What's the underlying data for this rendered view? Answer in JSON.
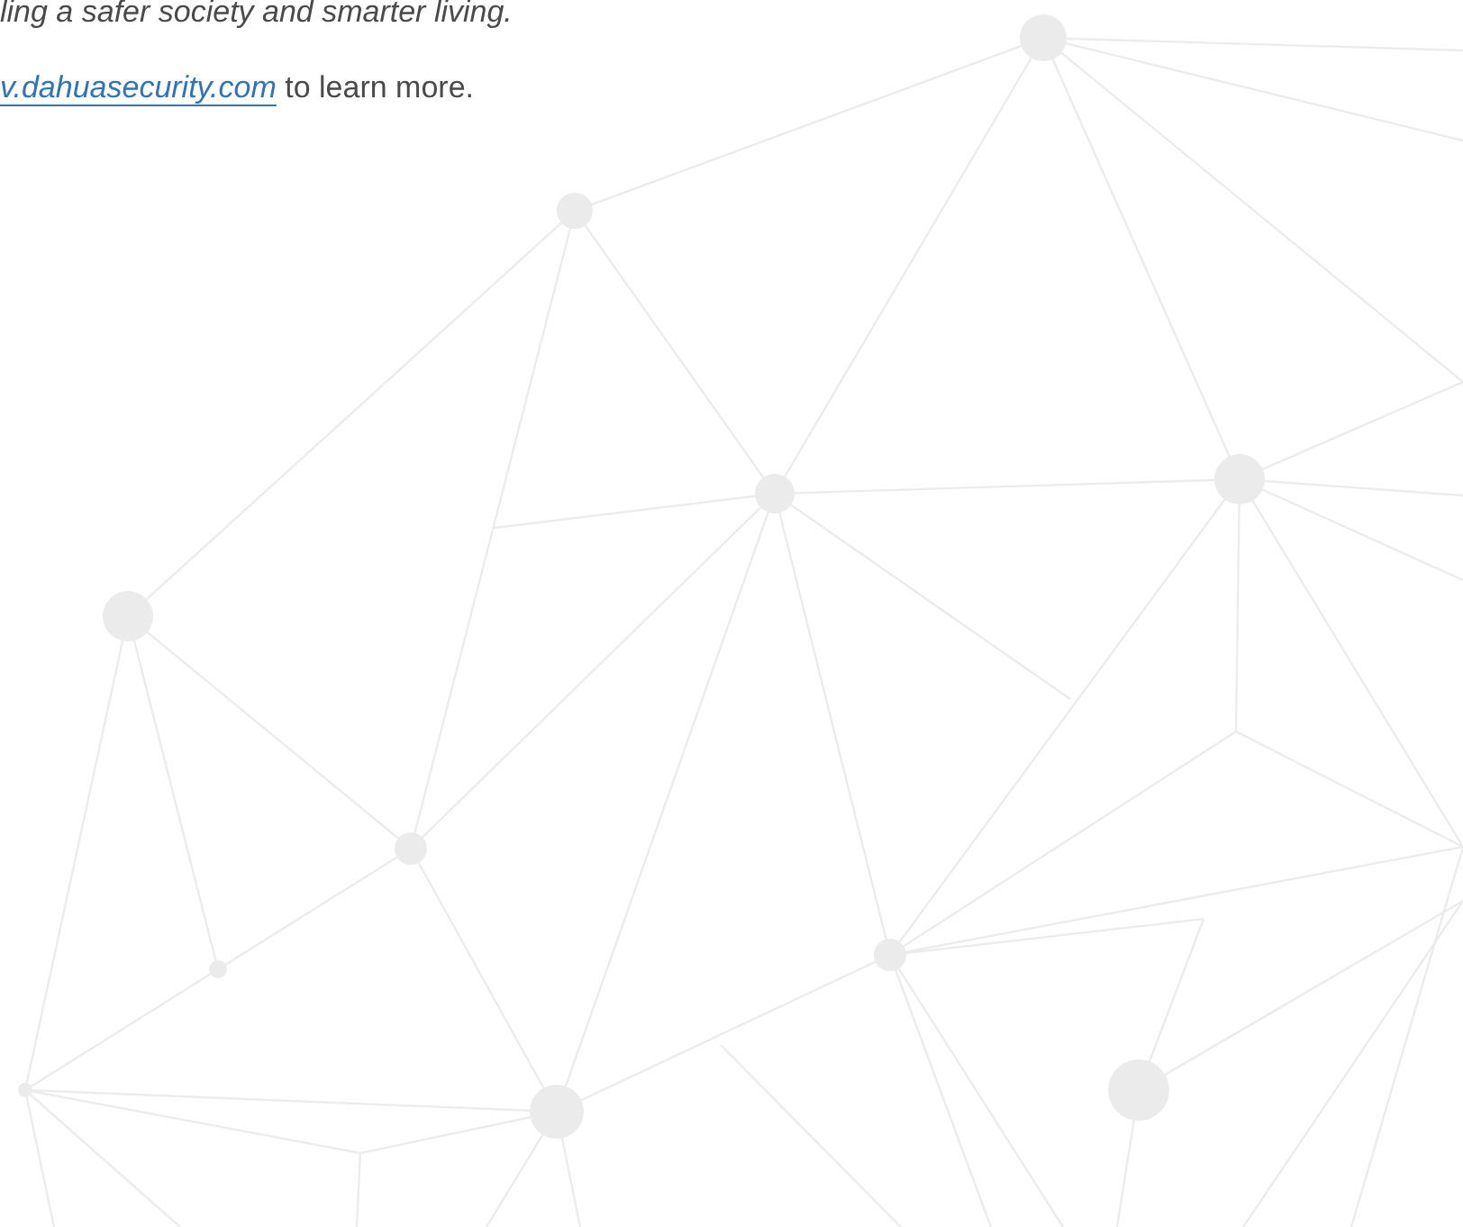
{
  "intro": {
    "line_1": "ling a safer society and smarter living.",
    "link": "v.dahuasecurity.com",
    "line_2_rest": "to learn more."
  }
}
